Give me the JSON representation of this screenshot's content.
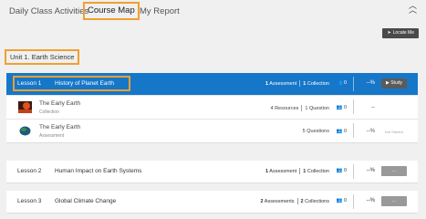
{
  "tabs": [
    {
      "label": "Daily Class Activities"
    },
    {
      "label": "Course Map"
    },
    {
      "label": "My Report"
    }
  ],
  "locate_label": "Locate Me",
  "unit_title": "Unit 1.  Earth Science",
  "lessons": [
    {
      "num": "Lesson 1",
      "title": "History of Planet Earth",
      "assessments_n": "1",
      "assessments_label": "Assessment",
      "collections_n": "1",
      "collections_label": "Collection",
      "members": "0",
      "pct": "--%",
      "button": "Study",
      "resources": [
        {
          "title": "The Early Earth",
          "sub": "Collection",
          "counts": "4 Resources",
          "counts2": "1 Question",
          "members": "0",
          "pct": "--",
          "status": ""
        },
        {
          "title": "The Early Earth",
          "sub": "Assessment",
          "counts": "5 Questions",
          "counts2": "",
          "members": "0",
          "pct": "--%",
          "status": "Not Started"
        }
      ]
    },
    {
      "num": "Lesson 2",
      "title": "Human Impact on Earth Systems",
      "assessments_n": "1",
      "assessments_label": "Assessment",
      "collections_n": "1",
      "collections_label": "Collection",
      "members": "0",
      "pct": "--%",
      "button": "..."
    },
    {
      "num": "Lesson 3",
      "title": "Global Climate Change",
      "assessments_n": "2",
      "assessments_label": "Assessments",
      "collections_n": "2",
      "collections_label": "Collections",
      "members": "0",
      "pct": "--%",
      "button": "..."
    }
  ],
  "colors": {
    "active_row": "#1677c9",
    "highlight": "#f0a030"
  },
  "icons": {
    "collapse": "double-chevron-up-icon",
    "locate": "location-arrow-icon",
    "members": "people-icon",
    "play": "play-icon"
  }
}
